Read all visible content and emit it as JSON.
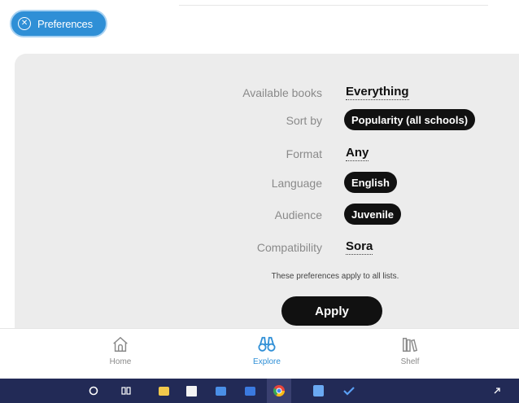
{
  "preferences_chip": {
    "label": "Preferences",
    "close_icon": "close-circle-icon",
    "color": "#2f8fd6"
  },
  "preferences": {
    "rows": [
      {
        "label": "Available books",
        "value": "Everything",
        "style": "plain"
      },
      {
        "label": "Sort by",
        "value": "Popularity (all schools)",
        "style": "pill"
      },
      {
        "label": "Format",
        "value": "Any",
        "style": "plain"
      },
      {
        "label": "Language",
        "value": "English",
        "style": "pill"
      },
      {
        "label": "Audience",
        "value": "Juvenile",
        "style": "pill"
      },
      {
        "label": "Compatibility",
        "value": "Sora",
        "style": "plain"
      }
    ],
    "note": "These preferences apply to all lists.",
    "apply_label": "Apply"
  },
  "bottom_nav": {
    "items": [
      {
        "label": "Home",
        "icon": "home-icon",
        "active": false
      },
      {
        "label": "Explore",
        "icon": "binoculars-icon",
        "active": true
      },
      {
        "label": "Shelf",
        "icon": "bookshelf-icon",
        "active": false
      }
    ],
    "active_color": "#2f8fd6"
  },
  "taskbar": {
    "background": "#222a56",
    "icons": [
      "cortana-circle-icon",
      "task-view-icon",
      "file-explorer-icon",
      "store-icon",
      "mail-icon",
      "calendar-icon",
      "chrome-icon",
      "notepad-icon",
      "todo-check-icon",
      "expand-arrow-icon"
    ]
  }
}
